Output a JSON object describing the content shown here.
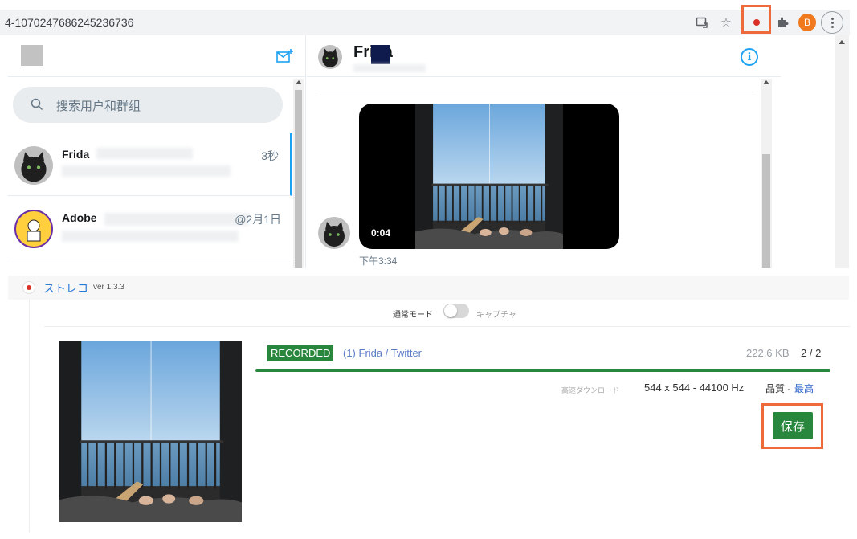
{
  "browser": {
    "url": "4-1070247686245236736",
    "profile_initial": "B",
    "colors": {
      "highlight": "#ef6a3b",
      "rec": "#d93025",
      "profile": "#f0791d"
    }
  },
  "dm": {
    "search_placeholder": "搜索用户和群组",
    "conversations": [
      {
        "name": "Frida",
        "time": "3秒"
      },
      {
        "name": "Adobe",
        "time": "@2月1日"
      }
    ],
    "header_name": "Frida",
    "video_duration": "0:04",
    "message_timestamp": "下午3:34"
  },
  "extension": {
    "name": "ストレコ",
    "version": "ver 1.3.3",
    "mode_label": "通常モード",
    "capture_label": "キャプチャ",
    "item": {
      "status": "RECORDED",
      "source": "(1) Frida / Twitter",
      "size": "222.6 KB",
      "count": "2 / 2",
      "progress": 1.0,
      "fast_download_label": "高速ダウンロード",
      "dimensions": "544 x 544 - 44100 Hz",
      "quality_label": "品質 -",
      "quality_value": "最高",
      "save_label": "保存"
    },
    "colors": {
      "brand": "#2a7bd6",
      "green": "#28873c"
    }
  }
}
